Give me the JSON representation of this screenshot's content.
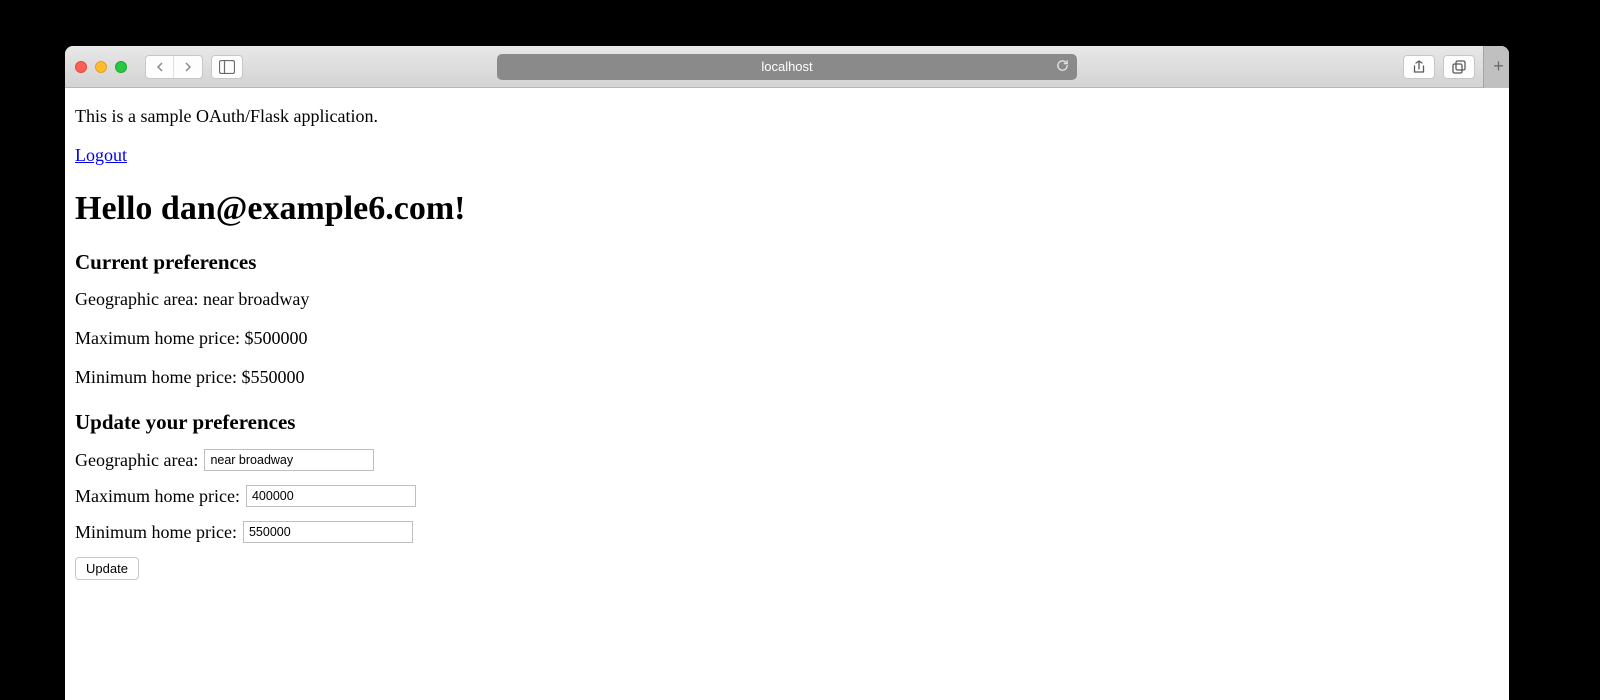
{
  "browser": {
    "address": "localhost"
  },
  "page": {
    "intro": "This is a sample OAuth/Flask application.",
    "logout_link": "Logout",
    "greeting": "Hello dan@example6.com!",
    "current_prefs_heading": "Current preferences",
    "prefs": {
      "geo_label": "Geographic area:",
      "geo_value": "near broadway",
      "max_label": "Maximum home price:",
      "max_value": "$500000",
      "min_label": "Minimum home price:",
      "min_value": "$550000"
    },
    "update_prefs_heading": "Update your preferences",
    "form": {
      "geo_label": "Geographic area:",
      "geo_value": "near broadway",
      "max_label": "Maximum home price:",
      "max_value": "400000",
      "min_label": "Minimum home price:",
      "min_value": "550000",
      "submit_label": "Update"
    }
  }
}
